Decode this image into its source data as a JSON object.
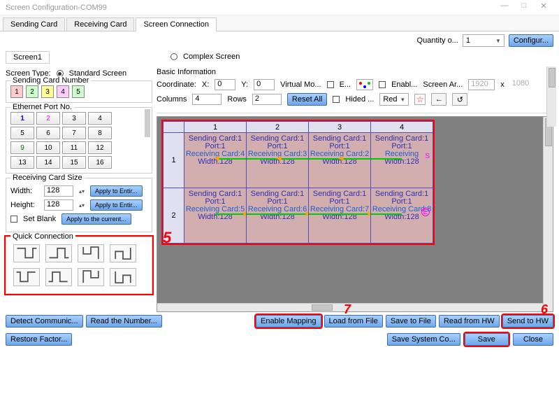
{
  "title": "Screen Configuration-COM99",
  "windowButtons": {
    "min": "—",
    "max": "□",
    "close": "✕"
  },
  "topTabs": {
    "sending": "Sending Card",
    "receiving": "Receiving Card",
    "connection": "Screen Connection"
  },
  "quantity": {
    "label": "Quantity o...",
    "value": "1",
    "configure": "Configur..."
  },
  "screenTab": "Screen1",
  "screenType": {
    "label": "Screen Type:",
    "standard": "Standard Screen",
    "complex": "Complex Screen"
  },
  "sendingCardNumber": {
    "title": "Sending Card Number",
    "cards": [
      "1",
      "2",
      "3",
      "4",
      "5"
    ]
  },
  "ethernet": {
    "title": "Ethernet Port No.",
    "ports": [
      "1",
      "2",
      "3",
      "4",
      "5",
      "6",
      "7",
      "8",
      "9",
      "10",
      "11",
      "12",
      "13",
      "14",
      "15",
      "16"
    ]
  },
  "rcsize": {
    "title": "Receiving Card Size",
    "widthLabel": "Width:",
    "width": "128",
    "heightLabel": "Height:",
    "height": "128",
    "applyEntire1": "Apply to Entir...",
    "applyEntire2": "Apply to Entir...",
    "setBlank": "Set Blank",
    "applyCurrent": "Apply to the current..."
  },
  "quick": {
    "title": "Quick Connection"
  },
  "basic": {
    "title": "Basic Information",
    "coord": "Coordinate:",
    "xLabel": "X:",
    "x": "0",
    "yLabel": "Y:",
    "y": "0",
    "virtual": "Virtual Mo...",
    "eCheck": "E...",
    "enable": "Enabl...",
    "screenAr": "Screen Ar...",
    "w": "1920",
    "xsep": "x",
    "h": "1080",
    "colsLabel": "Columns",
    "cols": "4",
    "rowsLabel": "Rows",
    "rows": "2",
    "reset": "Reset All",
    "hided": "Hided ...",
    "red": "Red"
  },
  "gridHeaders": [
    "1",
    "2",
    "3",
    "4"
  ],
  "gridRows": [
    "1",
    "2"
  ],
  "cellLines": {
    "sc": "Sending Card:1",
    "port": "Port:1",
    "rc4": "Receiving Card:4",
    "rc3": "Receiving Card:3",
    "rc2": "Receiving Card:2",
    "rc1": "Receiving",
    "rc5": "Receiving Card:5",
    "rc6": "Receiving Card:6",
    "rc7": "Receiving Card:7",
    "rc8": "Receiving Card:8",
    "w": "Width:128",
    "endS": "S",
    "endE": "E"
  },
  "callouts": {
    "five": "5",
    "six": "6",
    "seven": "7"
  },
  "footer": {
    "detect": "Detect Communic...",
    "readNum": "Read the Number...",
    "enableMap": "Enable Mapping",
    "loadFile": "Load from File",
    "saveFile": "Save to File",
    "readHW": "Read from HW",
    "sendHW": "Send to HW",
    "restore": "Restore Factor...",
    "saveSys": "Save System Co...",
    "save": "Save",
    "close": "Close"
  }
}
